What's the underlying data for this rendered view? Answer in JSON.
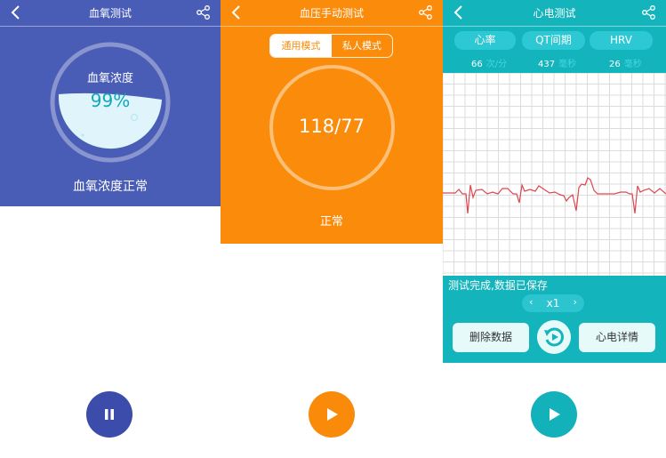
{
  "colors": {
    "oxygen_blue": "#4a5db6",
    "oxygen_button": "#3c4cab",
    "pressure_orange": "#fb8c0b",
    "ecg_teal": "#13b4bc",
    "ecg_trace": "#e0464e"
  },
  "oxygen": {
    "title": "血氧测试",
    "gauge_label": "血氧浓度",
    "gauge_value": "99%",
    "status": "血氧浓度正常",
    "level": 0.99,
    "back_icon": "chevron-left-icon",
    "share_icon": "share-icon",
    "action_icon": "pause-icon"
  },
  "pressure": {
    "title": "血压手动测试",
    "mode_general": "通用模式",
    "mode_private": "私人模式",
    "value": "118/77",
    "status": "正常",
    "back_icon": "chevron-left-icon",
    "share_icon": "share-icon",
    "action_icon": "play-icon"
  },
  "ecg": {
    "title": "心电测试",
    "tabs": [
      "心率",
      "QT间期",
      "HRV"
    ],
    "metrics": [
      {
        "value": "66",
        "unit": "次/分"
      },
      {
        "value": "437",
        "unit": "毫秒"
      },
      {
        "value": "26",
        "unit": "毫秒"
      }
    ],
    "done_text": "测试完成,数据已保存",
    "speed_value": "x1",
    "speed_left": "‹",
    "speed_right": "›",
    "delete_label": "删除数据",
    "detail_label": "心电详情",
    "back_icon": "chevron-left-icon",
    "share_icon": "share-icon",
    "replay_icon": "replay-icon",
    "action_icon": "play-icon"
  }
}
